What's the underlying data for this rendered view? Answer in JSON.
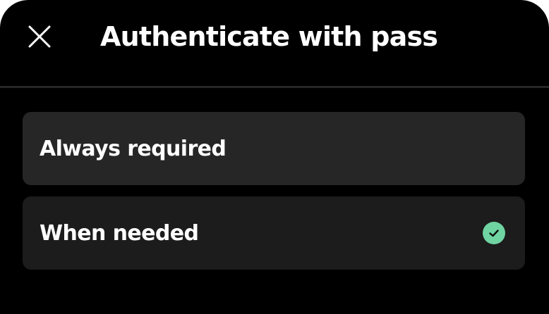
{
  "dialog": {
    "title": "Authenticate with pass…",
    "close_icon": "close-icon"
  },
  "options": [
    {
      "label": "Always required",
      "selected": false
    },
    {
      "label": "When needed",
      "selected": true
    }
  ],
  "colors": {
    "background": "#000000",
    "option_background": "#262626",
    "option_selected_background": "#1c1c1c",
    "check_accent": "#6fd3a2",
    "text": "#ffffff"
  },
  "icons": {
    "selected": "check-circle-icon"
  }
}
